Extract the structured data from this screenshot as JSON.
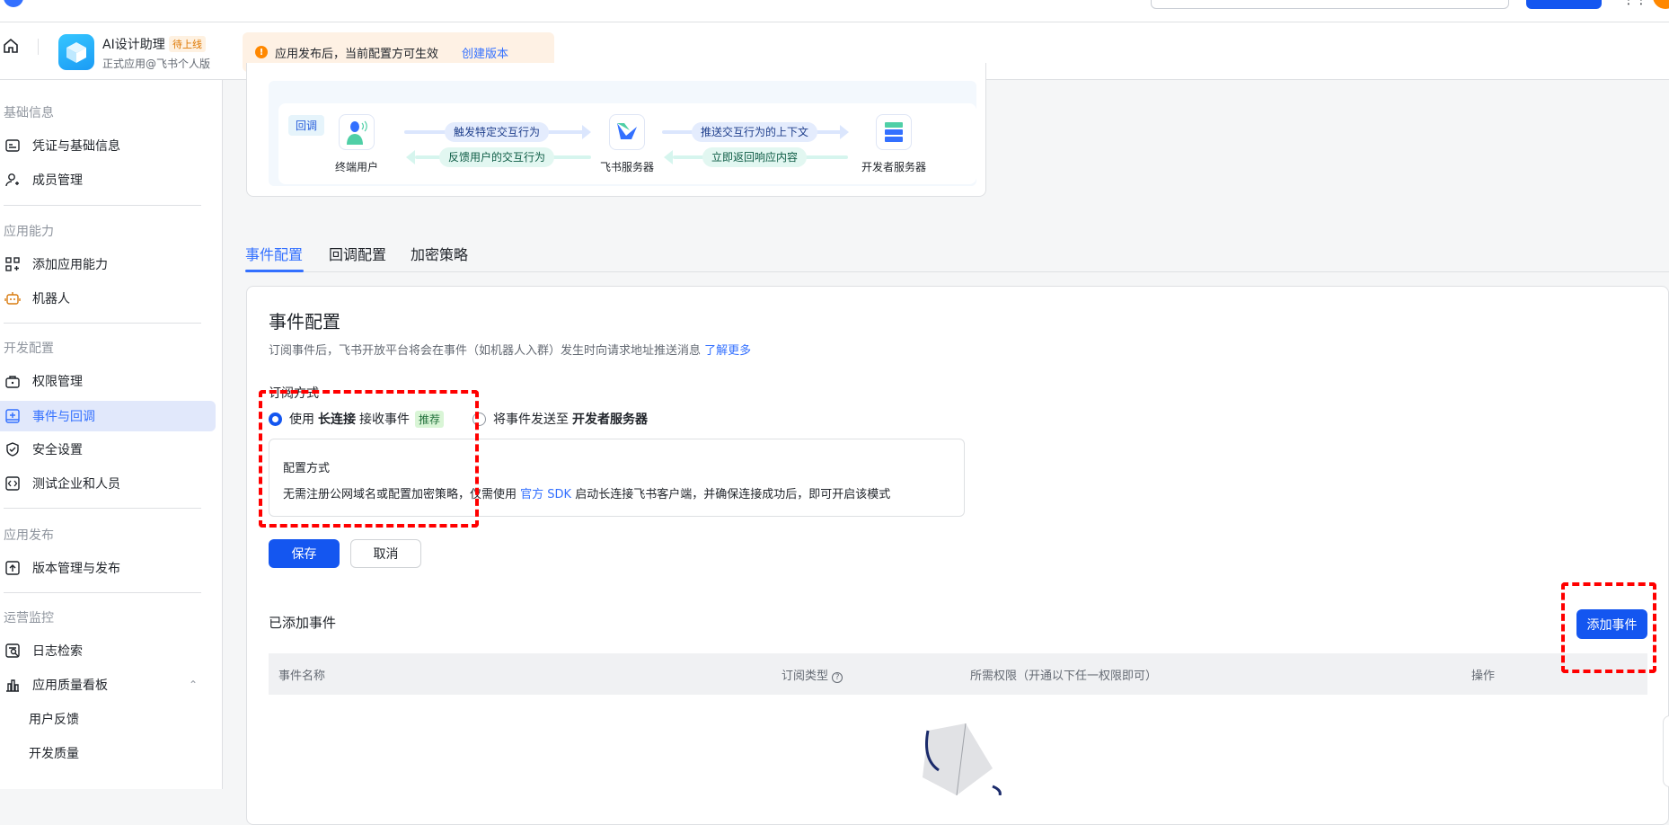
{
  "app": {
    "name": "AI设计助理",
    "status_badge": "待上线",
    "subtitle": "正式应用@飞书个人版"
  },
  "notice": {
    "text": "应用发布后，当前配置方可生效",
    "link": "创建版本"
  },
  "sidebar": {
    "sections": [
      "基础信息",
      "应用能力",
      "开发配置",
      "应用发布",
      "运营监控"
    ],
    "items": [
      {
        "label": "凭证与基础信息",
        "icon": "id-card-icon"
      },
      {
        "label": "成员管理",
        "icon": "user-add-icon"
      },
      {
        "label": "添加应用能力",
        "icon": "apps-add-icon"
      },
      {
        "label": "机器人",
        "icon": "robot-icon"
      },
      {
        "label": "权限管理",
        "icon": "lock-icon"
      },
      {
        "label": "事件与回调",
        "icon": "event-icon",
        "active": true
      },
      {
        "label": "安全设置",
        "icon": "shield-icon"
      },
      {
        "label": "测试企业和人员",
        "icon": "code-icon"
      },
      {
        "label": "版本管理与发布",
        "icon": "upload-icon"
      },
      {
        "label": "日志检索",
        "icon": "log-search-icon"
      },
      {
        "label": "应用质量看板",
        "icon": "bar-chart-icon",
        "expanded": true
      },
      {
        "label": "用户反馈"
      },
      {
        "label": "开发质量"
      }
    ]
  },
  "diagram": {
    "tag": "回调",
    "nodes": [
      "终端用户",
      "飞书服务器",
      "开发者服务器"
    ],
    "arrows": [
      "触发特定交互行为",
      "反馈用户的交互行为",
      "推送交互行为的上下文",
      "立即返回响应内容"
    ]
  },
  "tabs": [
    "事件配置",
    "回调配置",
    "加密策略"
  ],
  "event_config": {
    "title": "事件配置",
    "desc": "订阅事件后，飞书开放平台将会在事件（如机器人入群）发生时向请求地址推送消息",
    "learn_more": "了解更多",
    "subscribe_label": "订阅方式",
    "option1": {
      "prefix": "使用",
      "bold": "长连接",
      "suffix": "接收事件",
      "badge": "推荐",
      "selected": true
    },
    "option2": {
      "prefix": "将事件发送至",
      "bold": "开发者服务器",
      "selected": false
    },
    "config_box": {
      "title": "配置方式",
      "text1": "无需注册公网域名或配置加密策略，仅需使用",
      "link": "官方 SDK",
      "text2": "启动长连接飞书客户端，并确保连接成功后，即可开启该模式"
    },
    "save": "保存",
    "cancel": "取消"
  },
  "added_events": {
    "title": "已添加事件",
    "add_button": "添加事件",
    "columns": [
      "事件名称",
      "订阅类型",
      "所需权限（开通以下任一权限即可）",
      "操作"
    ]
  },
  "colors": {
    "primary": "#1456f0",
    "link": "#3370ff",
    "annotation": "#ff0000",
    "warning": "#ff8800"
  }
}
